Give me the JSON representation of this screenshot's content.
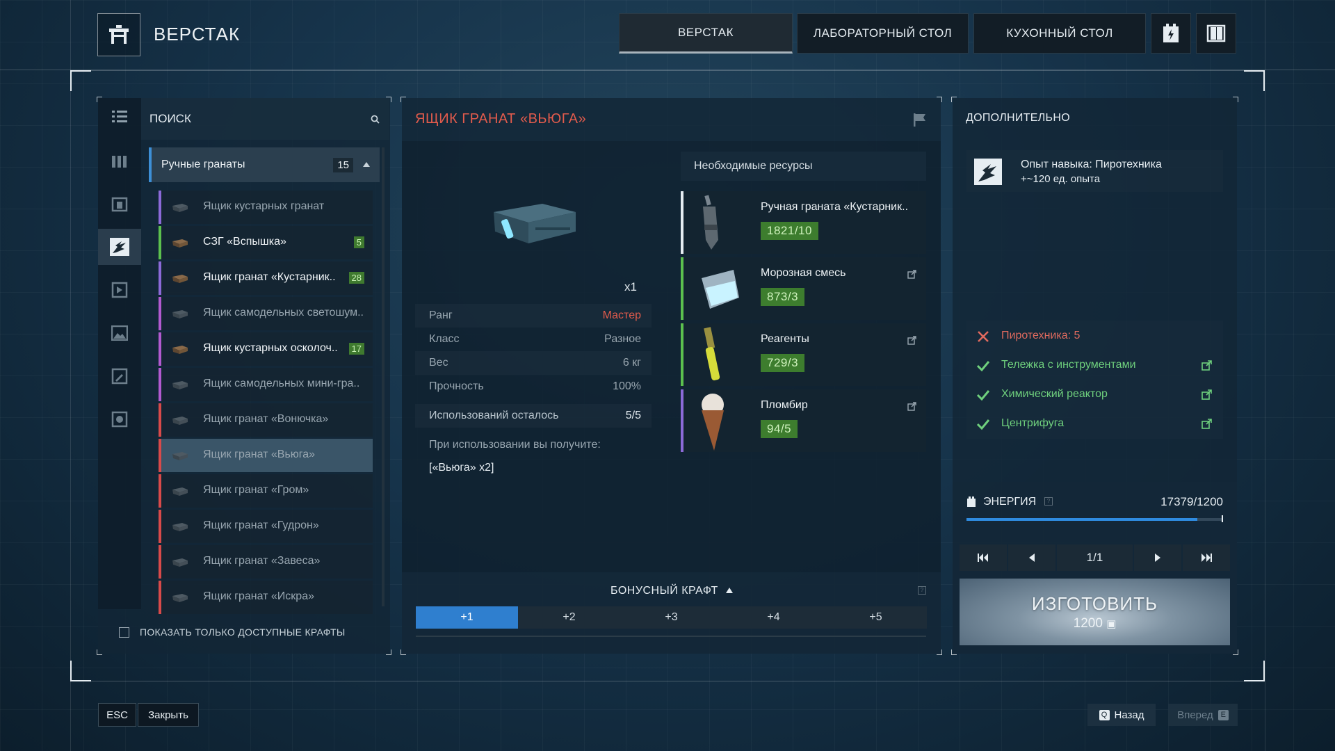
{
  "header": {
    "title": "ВЕРСТАК",
    "tabs": [
      "ВЕРСТАК",
      "ЛАБОРАТОРНЫЙ СТОЛ",
      "КУХОННЫЙ СТОЛ"
    ],
    "active_tab": "ВЕРСТАК"
  },
  "left": {
    "search_label": "ПОИСК",
    "category": {
      "label": "Ручные гранаты",
      "count": "15"
    },
    "items": [
      {
        "label": "Ящик кустарных гранат",
        "badge": "",
        "available": false,
        "color": "#8c6ad8"
      },
      {
        "label": "СЗГ «Вспышка»",
        "badge": "5",
        "available": true,
        "color": "#5cc04e"
      },
      {
        "label": "Ящик гранат «Кустарник..",
        "badge": "28",
        "available": true,
        "color": "#8c6ad8"
      },
      {
        "label": "Ящик самодельных светошум..",
        "badge": "",
        "available": false,
        "color": "#b25ad0"
      },
      {
        "label": "Ящик кустарных осколоч..",
        "badge": "17",
        "available": true,
        "color": "#b25ad0"
      },
      {
        "label": "Ящик самодельных мини-гра..",
        "badge": "",
        "available": false,
        "color": "#b25ad0"
      },
      {
        "label": "Ящик гранат «Вонючка»",
        "badge": "",
        "available": false,
        "color": "#d84a4a"
      },
      {
        "label": "Ящик гранат «Вьюга»",
        "badge": "",
        "available": false,
        "color": "#d84a4a",
        "selected": true
      },
      {
        "label": "Ящик гранат «Гром»",
        "badge": "",
        "available": false,
        "color": "#d84a4a"
      },
      {
        "label": "Ящик гранат «Гудрон»",
        "badge": "",
        "available": false,
        "color": "#d84a4a"
      },
      {
        "label": "Ящик гранат «Завеса»",
        "badge": "",
        "available": false,
        "color": "#d84a4a"
      },
      {
        "label": "Ящик гранат «Искра»",
        "badge": "",
        "available": false,
        "color": "#d84a4a"
      }
    ],
    "show_available_label": "ПОКАЗАТЬ ТОЛЬКО ДОСТУПНЫЕ КРАФТЫ"
  },
  "center": {
    "title": "ЯЩИК ГРАНАТ «ВЬЮГА»",
    "quantity": "x1",
    "stats": [
      {
        "label": "Ранг",
        "value": "Мастер"
      },
      {
        "label": "Класс",
        "value": "Разное"
      },
      {
        "label": "Вес",
        "value": "6 кг"
      },
      {
        "label": "Прочность",
        "value": "100%"
      },
      {
        "label": "Использований осталось",
        "value": "5/5"
      }
    ],
    "on_use_label": "При использовании вы получите:",
    "on_use_value": "[«Вьюга» x2]",
    "resources_title": "Необходимые ресурсы",
    "resources": [
      {
        "name": "Ручная граната «Кустарник..",
        "qty": "1821/10",
        "color": "#e6edf2",
        "link": false
      },
      {
        "name": "Морозная смесь",
        "qty": "873/3",
        "color": "#5cc04e",
        "link": true
      },
      {
        "name": "Реагенты",
        "qty": "729/3",
        "color": "#5cc04e",
        "link": true
      },
      {
        "name": "Пломбир",
        "qty": "94/5",
        "color": "#8c6ad8",
        "link": true
      }
    ],
    "bonus_title": "БОНУСНЫЙ КРАФТ",
    "bonus_tabs": [
      "+1",
      "+2",
      "+3",
      "+4",
      "+5"
    ]
  },
  "right": {
    "title": "ДОПОЛНИТЕЛЬНО",
    "skill_line1": "Опыт навыка: Пиротехника",
    "skill_line2": "+~120 ед. опыта",
    "requirements": [
      {
        "label": "Пиротехника: 5",
        "ok": false,
        "link": false
      },
      {
        "label": "Тележка с инструментами",
        "ok": true,
        "link": true
      },
      {
        "label": "Химический реактор",
        "ok": true,
        "link": true
      },
      {
        "label": "Центрифуга",
        "ok": true,
        "link": true
      }
    ],
    "energy_label": "ЭНЕРГИЯ",
    "energy_value": "17379/1200",
    "energy_fraction": 0.9,
    "page": "1/1",
    "craft_label": "ИЗГОТОВИТЬ",
    "craft_cost": "1200"
  },
  "footer": {
    "esc_key": "ESC",
    "close_label": "Закрыть",
    "back_key": "Q",
    "back_label": "Назад",
    "forward_label": "Вперед",
    "forward_key": "E"
  },
  "colors": {
    "accent": "#2f7fcf",
    "title_red": "#e25b4c",
    "ok_green": "#6fd07d",
    "qty_green": "#3d7d2e"
  }
}
